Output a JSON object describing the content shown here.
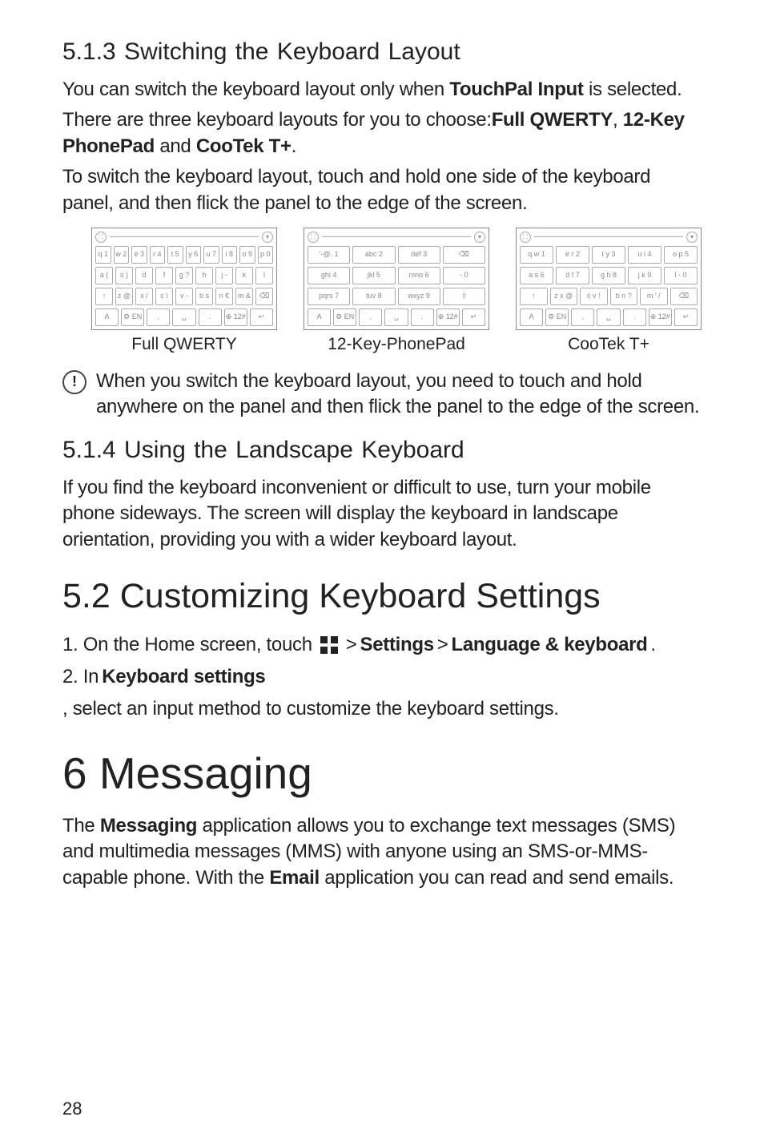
{
  "s513": {
    "heading": "5.1.3  Switching the Keyboard Layout",
    "p1_a": "You can switch the keyboard layout only when ",
    "p1_bold": "TouchPal Input",
    "p1_b": " is selected.",
    "p2_a": "There are three keyboard layouts for you to choose:",
    "p2_b1": "Full QWERTY",
    "p2_c": ", ",
    "p2_b2": "12-Key PhonePad",
    "p2_d": " and ",
    "p2_b3": "CooTek T+",
    "p2_e": ".",
    "p3": "To switch the keyboard layout, touch and hold one side of the keyboard panel, and then flick the panel to the edge of the screen."
  },
  "figures": {
    "qwerty": {
      "caption": "Full QWERTY",
      "rows": [
        [
          "q 1",
          "w 2",
          "e 3",
          "r 4",
          "t 5",
          "y 6",
          "u 7",
          "i 8",
          "o 9",
          "p 0"
        ],
        [
          "a (",
          "s )",
          "d",
          "f",
          "g ?",
          "h",
          "j -",
          "k",
          "l"
        ],
        [
          "↑",
          "z @",
          "x /",
          "c \\",
          "v -",
          "b s",
          "n €",
          "m &",
          "⌫"
        ],
        [
          "A",
          "⚙ EN",
          ",",
          "␣",
          ".",
          "⊕ 12#",
          "↵"
        ]
      ]
    },
    "phonepad": {
      "caption": "12-Key-PhonePad",
      "rows": [
        [
          "'-@. 1",
          "abc 2",
          "def 3",
          "⌫"
        ],
        [
          "ghi 4",
          "jkl 5",
          "mno 6",
          "- 0"
        ],
        [
          "pqrs 7",
          "tuv 8",
          "wxyz 9",
          "⇧"
        ],
        [
          "A",
          "⚙ EN",
          ",",
          "␣",
          ".",
          "⊕ 12#",
          "↵"
        ]
      ]
    },
    "cootek": {
      "caption": "CooTek T+",
      "rows": [
        [
          "q w 1",
          "e r 2",
          "t y 3",
          "u i 4",
          "o p 5"
        ],
        [
          "a s 6",
          "d f 7",
          "g h 8",
          "j k 9",
          "l - 0"
        ],
        [
          "↑",
          "z x @",
          "c v !",
          "b n ?",
          "m ' /",
          "⌫"
        ],
        [
          "A",
          "⚙ EN",
          ",",
          "␣",
          ".",
          "⊕ 12#",
          "↵"
        ]
      ]
    }
  },
  "note": {
    "text": "When you switch the keyboard layout, you need to touch and hold anywhere on the panel and then flick the panel to the edge of the screen."
  },
  "s514": {
    "heading": "5.1.4  Using the Landscape Keyboard",
    "p1": "If you find the keyboard inconvenient or difficult to use, turn your mobile phone sideways. The screen will display the keyboard in landscape orientation, providing you with a wider keyboard layout."
  },
  "s52": {
    "heading": "5.2  Customizing Keyboard Settings",
    "step1_a": "1. On the Home screen, touch ",
    "step1_b": " > ",
    "step1_b1": "Settings",
    "step1_c": " > ",
    "step1_b2": "Language & keyboard",
    "step1_d": ".",
    "step2_a": "2. In ",
    "step2_b1": "Keyboard settings",
    "step2_b": ", select an input method to customize the keyboard settings."
  },
  "ch6": {
    "heading": "6  Messaging",
    "p1_a": "The ",
    "p1_b1": "Messaging",
    "p1_b": " application allows you to exchange text messages (SMS) and multimedia messages (MMS) with anyone using an SMS-or-MMS-capable phone. With the ",
    "p1_b2": "Email",
    "p1_c": " application you can read and send emails."
  },
  "page_number": "28"
}
